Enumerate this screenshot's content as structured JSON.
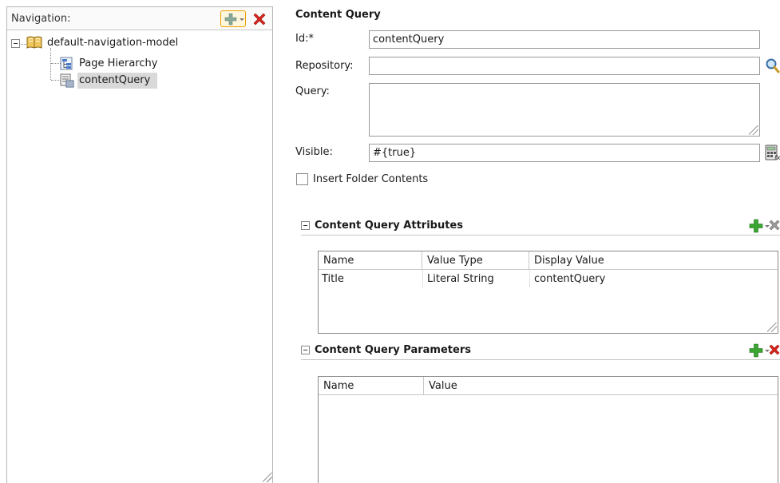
{
  "navigation": {
    "title": "Navigation:",
    "tree": {
      "root": "default-navigation-model",
      "children": [
        "Page Hierarchy",
        "contentQuery"
      ]
    }
  },
  "content_query": {
    "title": "Content Query",
    "fields": {
      "id_label": "Id:*",
      "id_value": "contentQuery",
      "repository_label": "Repository:",
      "repository_value": "",
      "query_label": "Query:",
      "visible_label": "Visible:",
      "visible_value": "#{true}"
    },
    "insert_folder_label": "Insert Folder Contents",
    "insert_folder_checked": false
  },
  "attributes": {
    "title": "Content Query Attributes",
    "columns": [
      "Name",
      "Value Type",
      "Display Value"
    ],
    "rows": [
      {
        "name": "Title",
        "value_type": "Literal String",
        "display_value": "contentQuery"
      }
    ]
  },
  "parameters": {
    "title": "Content Query Parameters",
    "columns": [
      "Name",
      "Value"
    ],
    "rows": []
  },
  "colors": {
    "add_green": "#3aa531",
    "delete_red": "#d7261e",
    "delete_gray": "#9c9c9c",
    "selection": "#d9d9d9"
  },
  "icons": [
    "add-icon",
    "delete-icon",
    "search-icon",
    "expression-builder-icon",
    "book-icon",
    "page-hierarchy-icon",
    "content-query-icon"
  ]
}
